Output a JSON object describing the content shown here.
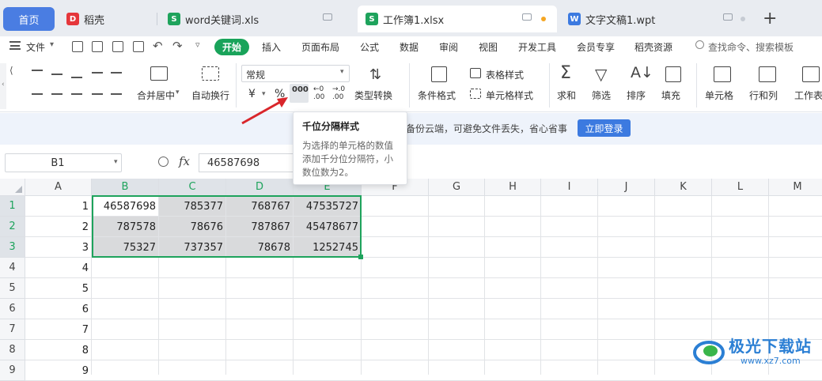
{
  "tabs": [
    {
      "label": "首页"
    },
    {
      "label": "稻壳"
    },
    {
      "label": "word关键词.xls"
    },
    {
      "label": "工作簿1.xlsx"
    },
    {
      "label": "文字文稿1.wpt"
    }
  ],
  "new_tab": "+",
  "menu": {
    "file": "文件",
    "items": [
      "开始",
      "插入",
      "页面布局",
      "公式",
      "数据",
      "审阅",
      "视图",
      "开发工具",
      "会员专享",
      "稻壳资源"
    ],
    "search_placeholder": "查找命令、搜索模板"
  },
  "ribbon": {
    "merge": "合并居中",
    "merge_arrow": "▾",
    "wrap": "自动换行",
    "number_format": "常规",
    "currency": "¥",
    "percent": "%",
    "thousands": "000",
    "inc_decimal": "←0 .00",
    "dec_decimal": "→.0 .00",
    "type_convert": "类型转换",
    "cond_format": "条件格式",
    "table_style": "表格样式",
    "cell_style": "单元格样式",
    "sum": "求和",
    "filter": "筛选",
    "sort": "排序",
    "fill": "填充",
    "cell": "单元格",
    "row_col": "行和列",
    "worksheet": "工作表"
  },
  "notice": {
    "text": "备份云端，可避免文件丢失，省心省事",
    "login": "立即登录"
  },
  "formula_bar": {
    "name_box": "B1",
    "fx": "fx",
    "value": "46587698"
  },
  "tooltip": {
    "title": "千位分隔样式",
    "body": "为选择的单元格的数值添加千分位分隔符，小数位数为2。"
  },
  "columns": [
    "A",
    "B",
    "C",
    "D",
    "E",
    "F",
    "G",
    "H",
    "I",
    "J",
    "K",
    "L",
    "M"
  ],
  "rows": [
    "1",
    "2",
    "3",
    "4",
    "5",
    "6",
    "7",
    "8",
    "9"
  ],
  "cells": {
    "A": [
      "1",
      "2",
      "3",
      "4",
      "5",
      "6",
      "7",
      "8",
      "9"
    ],
    "B": [
      "46587698",
      "787578",
      "75327"
    ],
    "C": [
      "785377",
      "78676",
      "737357"
    ],
    "D": [
      "768767",
      "787867",
      "78678"
    ],
    "E": [
      "47535727",
      "45478677",
      "1252745"
    ]
  },
  "watermark": {
    "text": "极光下载站",
    "url": "www.xz7.com"
  },
  "colors": {
    "accent_green": "#1ea35c",
    "home_tab": "#4a7de2",
    "login_button": "#3c7ae0",
    "arrow": "#d9262b"
  }
}
